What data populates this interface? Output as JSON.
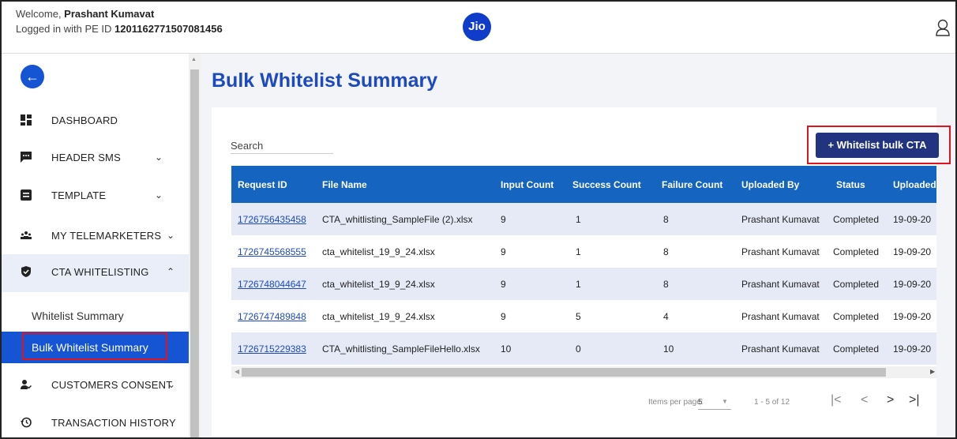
{
  "header": {
    "welcome_prefix": "Welcome, ",
    "user_name": "Prashant Kumavat",
    "login_prefix": "Logged in with PE ID ",
    "pe_id": "1201162771507081456",
    "logo_text": "Jio"
  },
  "sidebar": {
    "items": [
      {
        "label": "DASHBOARD",
        "icon": "dashboard-icon"
      },
      {
        "label": "HEADER SMS",
        "icon": "chat-icon",
        "chevron": "down"
      },
      {
        "label": "TEMPLATE",
        "icon": "template-icon",
        "chevron": "down"
      },
      {
        "label": "MY TELEMARKETERS",
        "icon": "group-icon",
        "chevron": "down"
      },
      {
        "label": "CTA WHITELISTING",
        "icon": "shield-icon",
        "chevron": "up"
      },
      {
        "label": "CUSTOMERS CONSENT",
        "icon": "person-check-icon",
        "chevron": "down"
      },
      {
        "label": "TRANSACTION HISTORY",
        "icon": "history-icon"
      }
    ],
    "subitems": [
      {
        "label": "Whitelist Summary"
      },
      {
        "label": "Bulk Whitelist Summary",
        "selected": true
      }
    ]
  },
  "main": {
    "title": "Bulk Whitelist Summary",
    "search_label": "Search",
    "cta_button": "+ Whitelist bulk CTA"
  },
  "table": {
    "columns": [
      "Request ID",
      "File Name",
      "Input Count",
      "Success Count",
      "Failure Count",
      "Uploaded By",
      "Status",
      "Uploaded"
    ],
    "rows": [
      {
        "request_id": "1726756435458",
        "file_name": "CTA_whitlisting_SampleFile (2).xlsx",
        "input": "9",
        "success": "1",
        "failure": "8",
        "uploaded_by": "Prashant Kumavat",
        "status": "Completed",
        "uploaded": "19-09-20"
      },
      {
        "request_id": "1726745568555",
        "file_name": "cta_whitelist_19_9_24.xlsx",
        "input": "9",
        "success": "1",
        "failure": "8",
        "uploaded_by": "Prashant Kumavat",
        "status": "Completed",
        "uploaded": "19-09-20"
      },
      {
        "request_id": "1726748044647",
        "file_name": "cta_whitelist_19_9_24.xlsx",
        "input": "9",
        "success": "1",
        "failure": "8",
        "uploaded_by": "Prashant Kumavat",
        "status": "Completed",
        "uploaded": "19-09-20"
      },
      {
        "request_id": "1726747489848",
        "file_name": "cta_whitelist_19_9_24.xlsx",
        "input": "9",
        "success": "5",
        "failure": "4",
        "uploaded_by": "Prashant Kumavat",
        "status": "Completed",
        "uploaded": "19-09-20"
      },
      {
        "request_id": "1726715229383",
        "file_name": "CTA_whitlisting_SampleFileHello.xlsx",
        "input": "10",
        "success": "0",
        "failure": "10",
        "uploaded_by": "Prashant Kumavat",
        "status": "Completed",
        "uploaded": "19-09-20"
      }
    ]
  },
  "paginator": {
    "items_per_page_label": "Items per page:",
    "page_size": "5",
    "range": "1 - 5 of 12"
  },
  "colors": {
    "primary": "#1554d3",
    "table_header": "#1564c0",
    "cta_button": "#22347f",
    "highlight": "#e0141e"
  }
}
